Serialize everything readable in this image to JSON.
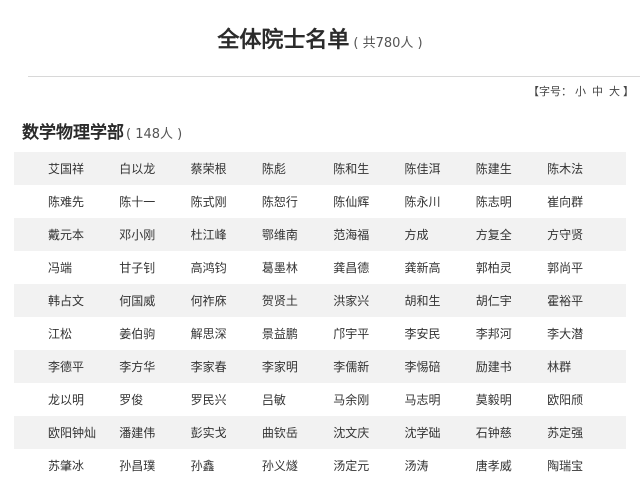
{
  "header": {
    "title": "全体院士名单",
    "count": "( 共780人 )"
  },
  "font_size": {
    "open": "【字号：",
    "small": "小",
    "medium": "中",
    "large": "大",
    "close": "】"
  },
  "section": {
    "name": "数学物理学部",
    "count": "( 148人 )",
    "rows": [
      [
        "艾国祥",
        "白以龙",
        "蔡荣根",
        "陈彪",
        "陈和生",
        "陈佳洱",
        "陈建生",
        "陈木法"
      ],
      [
        "陈难先",
        "陈十一",
        "陈式刚",
        "陈恕行",
        "陈仙辉",
        "陈永川",
        "陈志明",
        "崔向群"
      ],
      [
        "戴元本",
        "邓小刚",
        "杜江峰",
        "鄂维南",
        "范海福",
        "方成",
        "方复全",
        "方守贤"
      ],
      [
        "冯端",
        "甘子钊",
        "高鸿钧",
        "葛墨林",
        "龚昌德",
        "龚新高",
        "郭柏灵",
        "郭尚平"
      ],
      [
        "韩占文",
        "何国威",
        "何祚庥",
        "贺贤土",
        "洪家兴",
        "胡和生",
        "胡仁宇",
        "霍裕平"
      ],
      [
        "江松",
        "姜伯驹",
        "解思深",
        "景益鹏",
        "邝宇平",
        "李安民",
        "李邦河",
        "李大潜"
      ],
      [
        "李德平",
        "李方华",
        "李家春",
        "李家明",
        "李儒新",
        "李惕碚",
        "励建书",
        "林群"
      ],
      [
        "龙以明",
        "罗俊",
        "罗民兴",
        "吕敏",
        "马余刚",
        "马志明",
        "莫毅明",
        "欧阳颀"
      ],
      [
        "欧阳钟灿",
        "潘建伟",
        "彭实戈",
        "曲钦岳",
        "沈文庆",
        "沈学础",
        "石钟慈",
        "苏定强"
      ],
      [
        "苏肇冰",
        "孙昌璞",
        "孙鑫",
        "孙义燧",
        "汤定元",
        "汤涛",
        "唐孝威",
        "陶瑞宝"
      ]
    ]
  }
}
